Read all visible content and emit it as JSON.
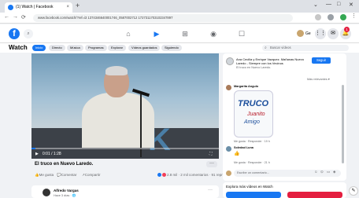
{
  "browser": {
    "tab_title": "(1) Watch | Facebook",
    "tab_close": "×",
    "new_tab": "+",
    "url": "www.facebook.com/watch/?ref=i3 1374346640001746_0587002712 1727311703102347897",
    "window_controls": [
      "⌄",
      "—",
      "□",
      "✕"
    ],
    "nav": [
      "←",
      "→",
      "⟳"
    ]
  },
  "header": {
    "logo": "f",
    "search_icon": "⌕",
    "user_name": "Ge",
    "notification_count": "1",
    "nav_icons": [
      "⌂",
      "▶",
      "⊞",
      "◉",
      "☐"
    ],
    "right_icons": [
      "⋮⋮",
      "✉",
      "🔔"
    ]
  },
  "watch": {
    "title": "Watch",
    "pills": [
      "Inicio",
      "Directo",
      "Música",
      "Programas",
      "Explorar",
      "Vídeos guardados",
      "Siguiendo"
    ],
    "search_placeholder": "Buscar vídeos",
    "search_icon": "⌕"
  },
  "video": {
    "overlay_text": "K",
    "time": "0:01 / 1:28",
    "progress": 0.02,
    "controls": [
      "▶",
      "⛶"
    ],
    "title": "El truco en Nuevo Laredo.",
    "more": "···"
  },
  "post_actions": {
    "like": "Me gusta",
    "comment": "Comentar",
    "share": "Compartir",
    "reactions": "2.8 mil · 2 mil comentarios · 91 reproducciones"
  },
  "next_post": {
    "name": "Alfredo Vargas",
    "sub": "Hace 3 días · 🌐",
    "more": "···"
  },
  "side": {
    "page_name": "Ana Cecilia y Enrique Vazquez. Mañanas Nuevo Laredo - Siempre con los Vecinos",
    "page_sub": "El truco en Nuevo Laredo.",
    "follow": "Seguir",
    "sort": "Más relevantes ▾",
    "comment1": {
      "name": "Margarita Angulo",
      "sticker_lines": [
        "TRUCO",
        "Juanito",
        "Amigo"
      ],
      "meta": "Me gusta · Responder · 19 h"
    },
    "comment2": {
      "name": "Soledad Luna",
      "emoji": "👍",
      "meta": "Me gusta · Responder · 21 h"
    },
    "write_placeholder": "Escribe un comentario...",
    "write_icons": [
      "☺",
      "⊙",
      "▭",
      "◈"
    ]
  },
  "explore": {
    "label": "Explora más vídeos en Watch"
  },
  "fab": "✎",
  "colors": {
    "brand": "#1877f2",
    "explore_btn1": "#1877f2",
    "explore_btn2": "#e41e3f"
  }
}
